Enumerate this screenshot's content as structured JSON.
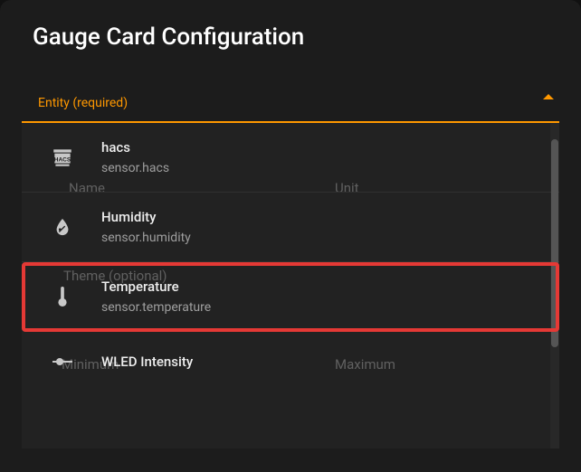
{
  "header": {
    "title": "Gauge Card Configuration"
  },
  "entity_field": {
    "label": "Entity (required)"
  },
  "ghost_fields": {
    "name": "Name",
    "unit": "Unit",
    "theme": "Theme (optional)",
    "minimum": "Minimum",
    "maximum": "Maximum"
  },
  "options": [
    {
      "name": "hacs",
      "id": "sensor.hacs",
      "icon": "hacs"
    },
    {
      "name": "Humidity",
      "id": "sensor.humidity",
      "icon": "water"
    },
    {
      "name": "Temperature",
      "id": "sensor.temperature",
      "icon": "thermometer",
      "highlighted": true
    },
    {
      "name": "WLED Intensity",
      "id": "",
      "icon": "slider"
    }
  ]
}
